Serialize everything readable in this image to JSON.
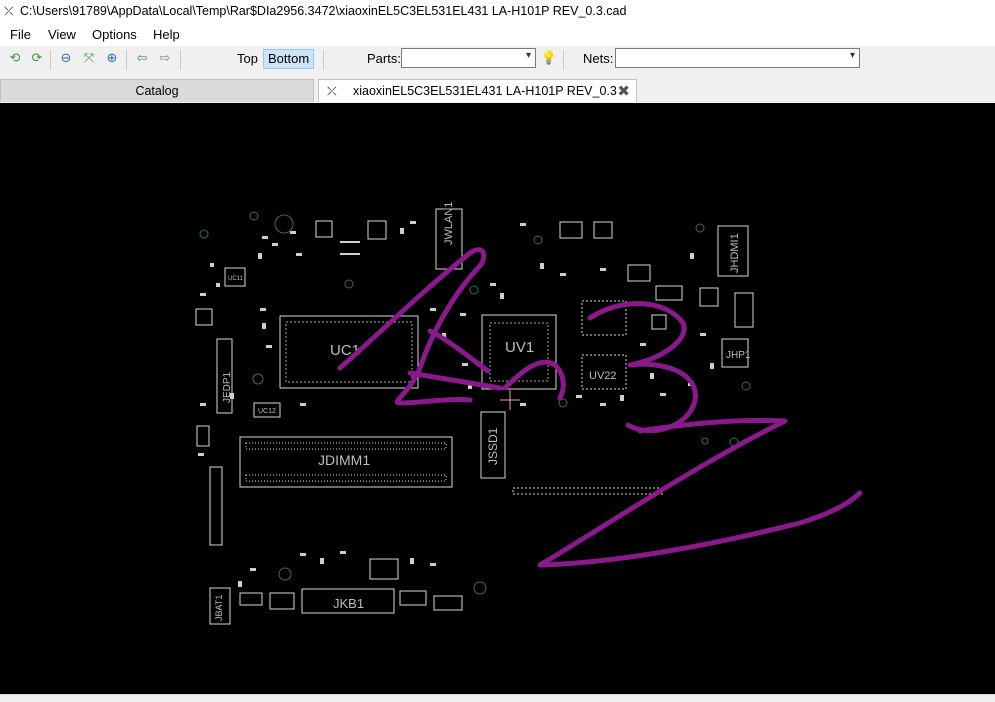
{
  "window": {
    "title": "C:\\Users\\91789\\AppData\\Local\\Temp\\Rar$DIa2956.3472\\xiaoxinEL5C3EL531EL431 LA-H101P REV_0.3.cad"
  },
  "menu": {
    "items": [
      "File",
      "View",
      "Options",
      "Help"
    ]
  },
  "toolbar": {
    "top_label": "Top",
    "bottom_label": "Bottom",
    "active_side": "Bottom",
    "parts_label": "Parts:",
    "parts_value": "",
    "nets_label": "Nets:",
    "nets_value": ""
  },
  "tabs": [
    {
      "label": "Catalog",
      "active": false
    },
    {
      "label": "xiaoxinEL5C3EL531EL431 LA-H101P REV_0.3",
      "active": true
    }
  ],
  "board": {
    "labels": [
      "JWLAN1",
      "JHDMI1",
      "JHP1",
      "UC1",
      "UV1",
      "UV22",
      "JEDP1",
      "JDIMM1",
      "JSSD1",
      "JKB1",
      "JBAT1",
      "UC12",
      "UC11"
    ],
    "annotation_color": "#8a1a8c",
    "silkscreen_color": "#d8d8d8"
  }
}
